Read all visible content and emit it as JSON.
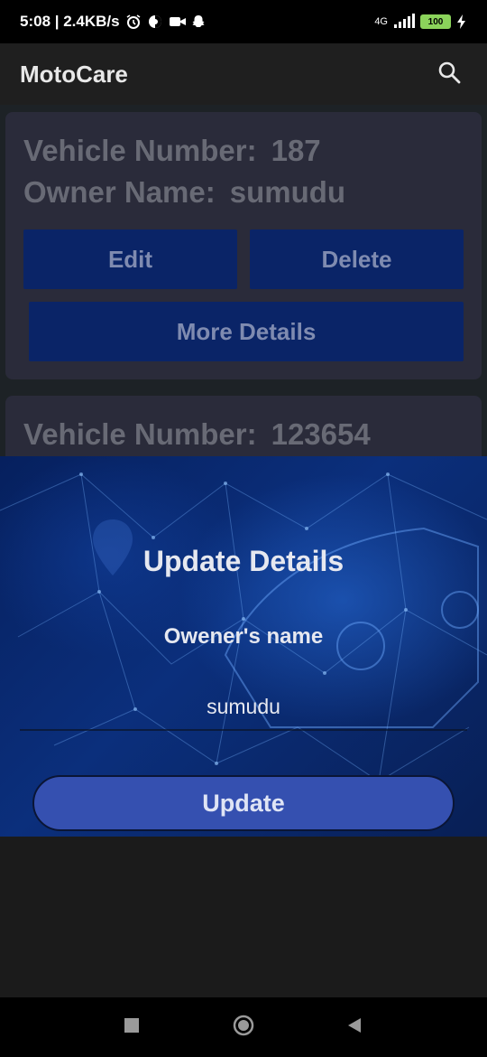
{
  "status_bar": {
    "time_speed": "5:08 | 2.4KB/s",
    "network": "4G",
    "battery": "100",
    "icons": [
      "alarm-icon",
      "data-saver-icon",
      "video-icon",
      "snapchat-icon",
      "signal-icon",
      "battery-icon",
      "charging-icon"
    ]
  },
  "app_bar": {
    "title": "MotoCare",
    "search_icon": "search-icon"
  },
  "cards": [
    {
      "vehicle_label": "Vehicle Number:",
      "vehicle_value": "187",
      "owner_label": "Owner Name:",
      "owner_value": "sumudu",
      "edit_label": "Edit",
      "delete_label": "Delete",
      "more_label": "More Details"
    },
    {
      "vehicle_label": "Vehicle Number:",
      "vehicle_value": "123654"
    }
  ],
  "update_sheet": {
    "title": "Update Details",
    "field_label": "Owener's name",
    "field_value": "sumudu",
    "button_label": "Update"
  },
  "nav_bar": {
    "icons": [
      "recents-icon",
      "home-icon",
      "back-icon"
    ]
  },
  "colors": {
    "accent_dark_button": "#0a2467",
    "update_button": "#3550b0",
    "card_bg": "#2a2b3a",
    "battery": "#8bd35b"
  }
}
